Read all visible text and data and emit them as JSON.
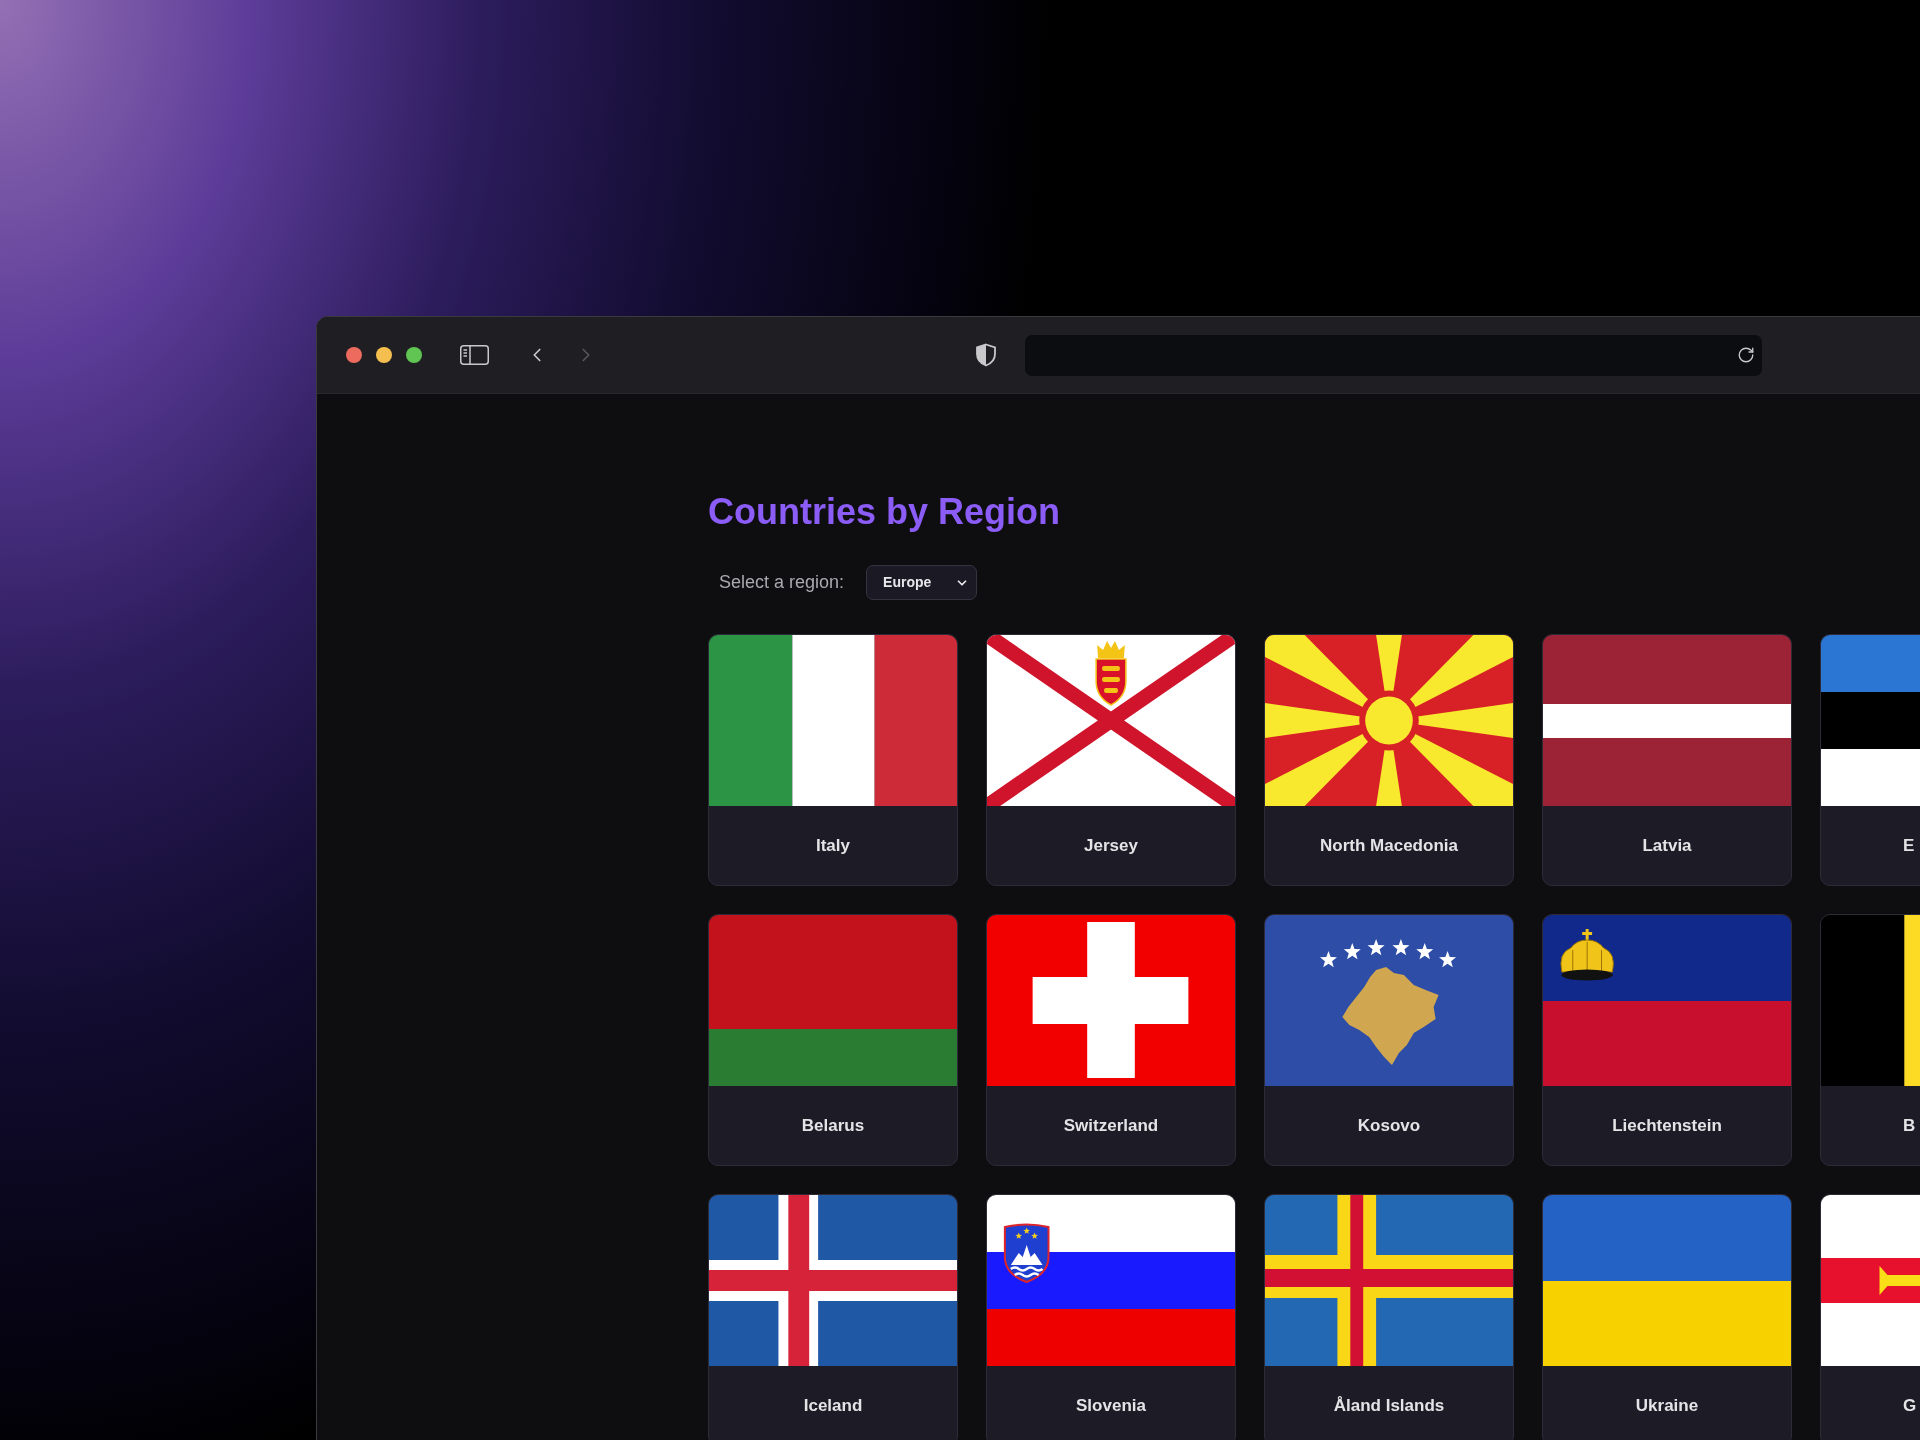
{
  "browser": {
    "navigation": [
      {
        "kind": "back",
        "disabled": false
      },
      {
        "kind": "forward",
        "disabled": true
      }
    ]
  },
  "page": {
    "title": "Countries by Region",
    "region_filter": {
      "label": "Select a region:",
      "value": "Europe"
    }
  },
  "countries": [
    {
      "name": "Italy",
      "kind": "italy"
    },
    {
      "name": "Jersey",
      "kind": "jersey"
    },
    {
      "name": "North Macedonia",
      "kind": "macedonia"
    },
    {
      "name": "Latvia",
      "kind": "latvia"
    },
    {
      "name": "E",
      "kind": "estonia"
    },
    {
      "name": "Belarus",
      "kind": "belarus"
    },
    {
      "name": "Switzerland",
      "kind": "switzerland"
    },
    {
      "name": "Kosovo",
      "kind": "kosovo"
    },
    {
      "name": "Liechtenstein",
      "kind": "liechtenstein"
    },
    {
      "name": "B",
      "kind": "belgium"
    },
    {
      "name": "Iceland",
      "kind": "iceland"
    },
    {
      "name": "Slovenia",
      "kind": "slovenia"
    },
    {
      "name": "Åland Islands",
      "kind": "aland"
    },
    {
      "name": "Ukraine",
      "kind": "ukraine"
    },
    {
      "name": "G",
      "kind": "guernsey"
    }
  ]
}
